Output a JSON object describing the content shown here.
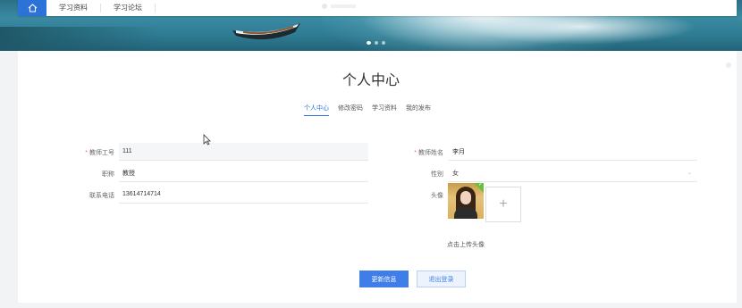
{
  "nav": {
    "items": [
      "学习资料",
      "学习论坛"
    ]
  },
  "page": {
    "title": "个人中心"
  },
  "tabs": [
    "个人中心",
    "修改密码",
    "学习资料",
    "我的发布"
  ],
  "form": {
    "teacher_id": {
      "label": "教师工号",
      "value": "111"
    },
    "title": {
      "label": "职称",
      "value": "教授"
    },
    "phone": {
      "label": "联系电话",
      "value": "13614714714"
    },
    "teacher_name": {
      "label": "教师姓名",
      "value": "李月"
    },
    "gender": {
      "label": "性别",
      "value": "女"
    },
    "avatar": {
      "label": "头像",
      "upload_hint": "点击上传头像",
      "plus": "+"
    }
  },
  "buttons": {
    "update": "更新信息",
    "logout": "退出登录"
  },
  "colors": {
    "primary": "#3f7ee8",
    "required": "#f56c6c"
  }
}
